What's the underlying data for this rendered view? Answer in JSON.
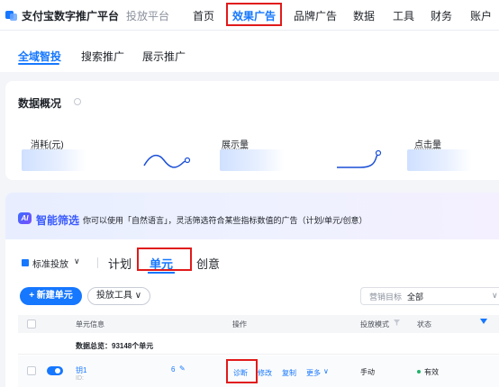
{
  "header": {
    "brand": "支付宝数字推广平台",
    "platform": "投放平台",
    "nav": [
      "首页",
      "效果广告",
      "品牌广告",
      "数据",
      "工具",
      "财务",
      "账户"
    ],
    "active_nav": "效果广告"
  },
  "subtabs": {
    "items": [
      "全域智投",
      "搜索推广",
      "展示推广"
    ],
    "active": "全域智投"
  },
  "overview": {
    "title": "数据概况",
    "metrics": [
      "消耗(元)",
      "展示量",
      "点击量"
    ]
  },
  "ai_filter": {
    "icon_text": "AI",
    "title": "智能筛选",
    "description": "你可以使用「自然语言」，灵活筛选符合某些指标数值的广告（计划/单元/创意）"
  },
  "level": {
    "standard_label": "标准投放",
    "tabs": [
      "计划",
      "单元",
      "创意"
    ],
    "active": "单元"
  },
  "toolbar": {
    "new_unit": "+ 新建单元",
    "tools": "投放工具 ∨",
    "goal_label": "营销目标",
    "goal_value": "全部"
  },
  "table": {
    "headers": [
      "单元信息",
      "操作",
      "投放模式",
      "状态"
    ],
    "summary": "数据总览：93148个单元",
    "rows": [
      {
        "name": "钥1",
        "id_label": "ID:",
        "count": "6",
        "actions": [
          "诊断",
          "修改",
          "复制",
          "更多"
        ],
        "mode": "手动",
        "status": "有效"
      }
    ]
  },
  "colors": {
    "accent": "#1677ff",
    "highlight_box": "#e11a1a",
    "status_ok": "#20b26b"
  }
}
